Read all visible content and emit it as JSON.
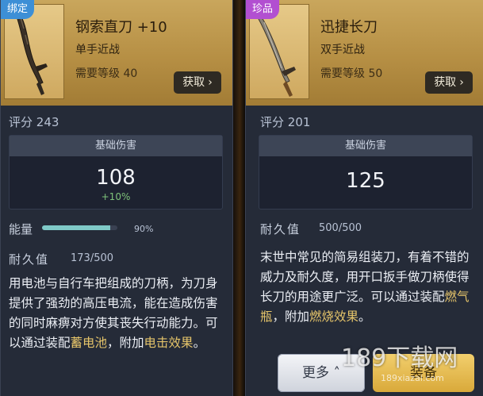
{
  "left": {
    "badge": "绑定",
    "name": "钢索直刀  +10",
    "type": "单手近战",
    "req": "需要等级 40",
    "get_label": "获取",
    "score_label": "评分",
    "score": "243",
    "dmg_header": "基础伤害",
    "dmg_value": "108",
    "dmg_bonus": "+10%",
    "energy_label": "能量",
    "energy_pct": "90%",
    "energy_fraction": 0.9,
    "durability_label": "耐久值",
    "durability": "173/500",
    "desc_plain1": "用电池与自行车把组成的刀柄，为刀身提供了强劲的高压电流，能在造成伤害的同时麻痹对方使其丧失行动能力。可以通过装配",
    "desc_hl1": "蓄电池",
    "desc_plain2": "，附加",
    "desc_hl2": "电击效果",
    "desc_plain3": "。"
  },
  "right": {
    "badge": "珍品",
    "name": "迅捷长刀",
    "type": "双手近战",
    "req": "需要等级 50",
    "get_label": "获取",
    "score_label": "评分",
    "score": "201",
    "dmg_header": "基础伤害",
    "dmg_value": "125",
    "durability_label": "耐久值",
    "durability": "500/500",
    "desc_plain1": "末世中常见的简易组装刀，有着不错的威力及耐久度，用开口扳手做刀柄使得长刀的用途更广泛。可以通过装配",
    "desc_hl1": "燃气瓶",
    "desc_plain2": "，附加",
    "desc_hl2": "燃烧效果",
    "desc_plain3": "。"
  },
  "buttons": {
    "more": "更多",
    "equip": "装备"
  },
  "watermark": {
    "main": "189下载网",
    "sub": "189xiazai.com"
  },
  "colors": {
    "accent_gold": "#e5c46a",
    "energy": "#7fc9c7",
    "bound_badge": "#3d8fd6",
    "rare_badge": "#b24fd1"
  }
}
